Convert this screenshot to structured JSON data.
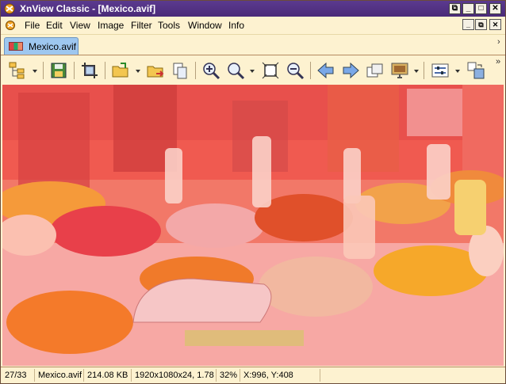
{
  "window": {
    "title": "XnView Classic - [Mexico.avif]",
    "buttons": [
      "restore-icon",
      "minimize-icon",
      "maximize-icon",
      "close-icon"
    ]
  },
  "menu": {
    "items": [
      "File",
      "Edit",
      "View",
      "Image",
      "Filter",
      "Tools",
      "Window",
      "Info"
    ],
    "mdi_buttons": [
      "mdi-minimize-icon",
      "mdi-restore-icon",
      "mdi-close-icon"
    ]
  },
  "tabs": [
    {
      "label": "Mexico.avif",
      "active": true
    }
  ],
  "toolbar": {
    "icons": [
      "browser-tree-icon",
      "save-icon",
      "crop-icon",
      "open-icon",
      "move-icon",
      "copy-icon",
      "zoom-in-icon",
      "zoom-icon",
      "fit-screen-icon",
      "zoom-out-icon",
      "previous-icon",
      "next-icon",
      "slideshow-icon",
      "monitor-icon",
      "settings-icon",
      "convert-icon"
    ]
  },
  "image": {
    "description_colors": {
      "overlay": "#f37a6a"
    }
  },
  "status": {
    "index": "27/33",
    "filename": "Mexico.avif",
    "filesize": "214.08 KB",
    "dimensions": "1920x1080x24, 1.78",
    "zoom": "32%",
    "coords": "X:996, Y:408"
  },
  "colors": {
    "titlebar": "#4a2a78",
    "chrome": "#fdf2d0",
    "tab_active": "#9ec7ef"
  }
}
